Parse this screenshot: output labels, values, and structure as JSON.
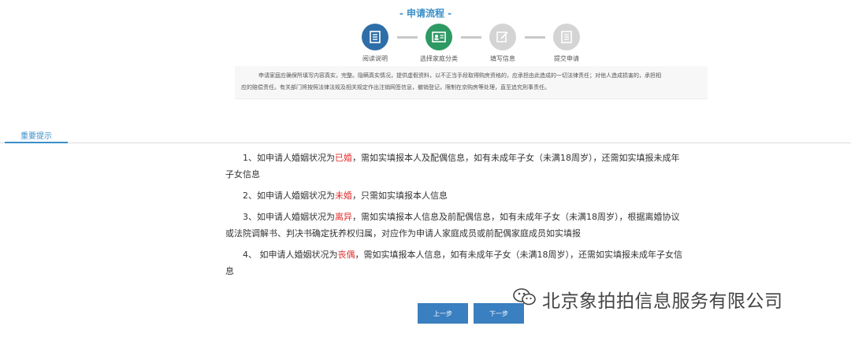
{
  "flow": {
    "title": "- 申请流程 -",
    "steps": [
      {
        "label": "阅读说明",
        "state": "done",
        "color": "#2e6ea8",
        "icon": "document-icon"
      },
      {
        "label": "选择家庭分类",
        "state": "current",
        "color": "#2e9a63",
        "icon": "id-card-icon"
      },
      {
        "label": "填写信息",
        "state": "pending",
        "color": "#d4d4d4",
        "icon": "edit-icon"
      },
      {
        "label": "提交申请",
        "state": "pending",
        "color": "#d4d4d4",
        "icon": "document-icon"
      }
    ]
  },
  "notice": {
    "line1": "申请家庭应确保所填写内容真实，完整。隐瞒真实情况，提供虚假资料，以不正当手段取得购房资格的，应承担由此造成的一切法律责任；对他人造成损害的，承担相",
    "line2": "应的赔偿责任。有关部门将按照法律法规及相关规定作出注销网签信息，撤销登记，限制在京购房等处理，直至追究刑事责任。"
  },
  "tab": {
    "label": "重要提示"
  },
  "tips": [
    {
      "pre": "1、如申请人婚姻状况为",
      "status": "已婚",
      "post1": "，需如实填报本人及配偶信息，如有未成年子女（未满18周岁），还需如实填报未成年",
      "post2": "子女信息"
    },
    {
      "pre": "2、如申请人婚姻状况为",
      "status": "未婚",
      "post1": "，只需如实填报本人信息",
      "post2": ""
    },
    {
      "pre": "3、如申请人婚姻状况为",
      "status": "离异",
      "post1": "，需如实填报本人信息及前配偶信息，如有未成年子女（未满18周岁），根据离婚协议",
      "post2": "或法院调解书、判决书确定抚养权归属，对应作为申请人家庭成员或前配偶家庭成员如实填报"
    },
    {
      "pre": "4、 如申请人婚姻状况为",
      "status": "丧偶",
      "post1": "，需如实填报本人信息，如有未成年子女（未满18周岁），还需如实填报未成年子女信",
      "post2": "息"
    }
  ],
  "buttons": {
    "prev": "上一步",
    "next": "下一步"
  },
  "watermark": {
    "text": "北京象拍拍信息服务有限公司",
    "icon": "wechat-icon"
  },
  "colors": {
    "accent": "#3a8fc8",
    "highlight": "#e03030",
    "button": "#3a7fc0"
  }
}
